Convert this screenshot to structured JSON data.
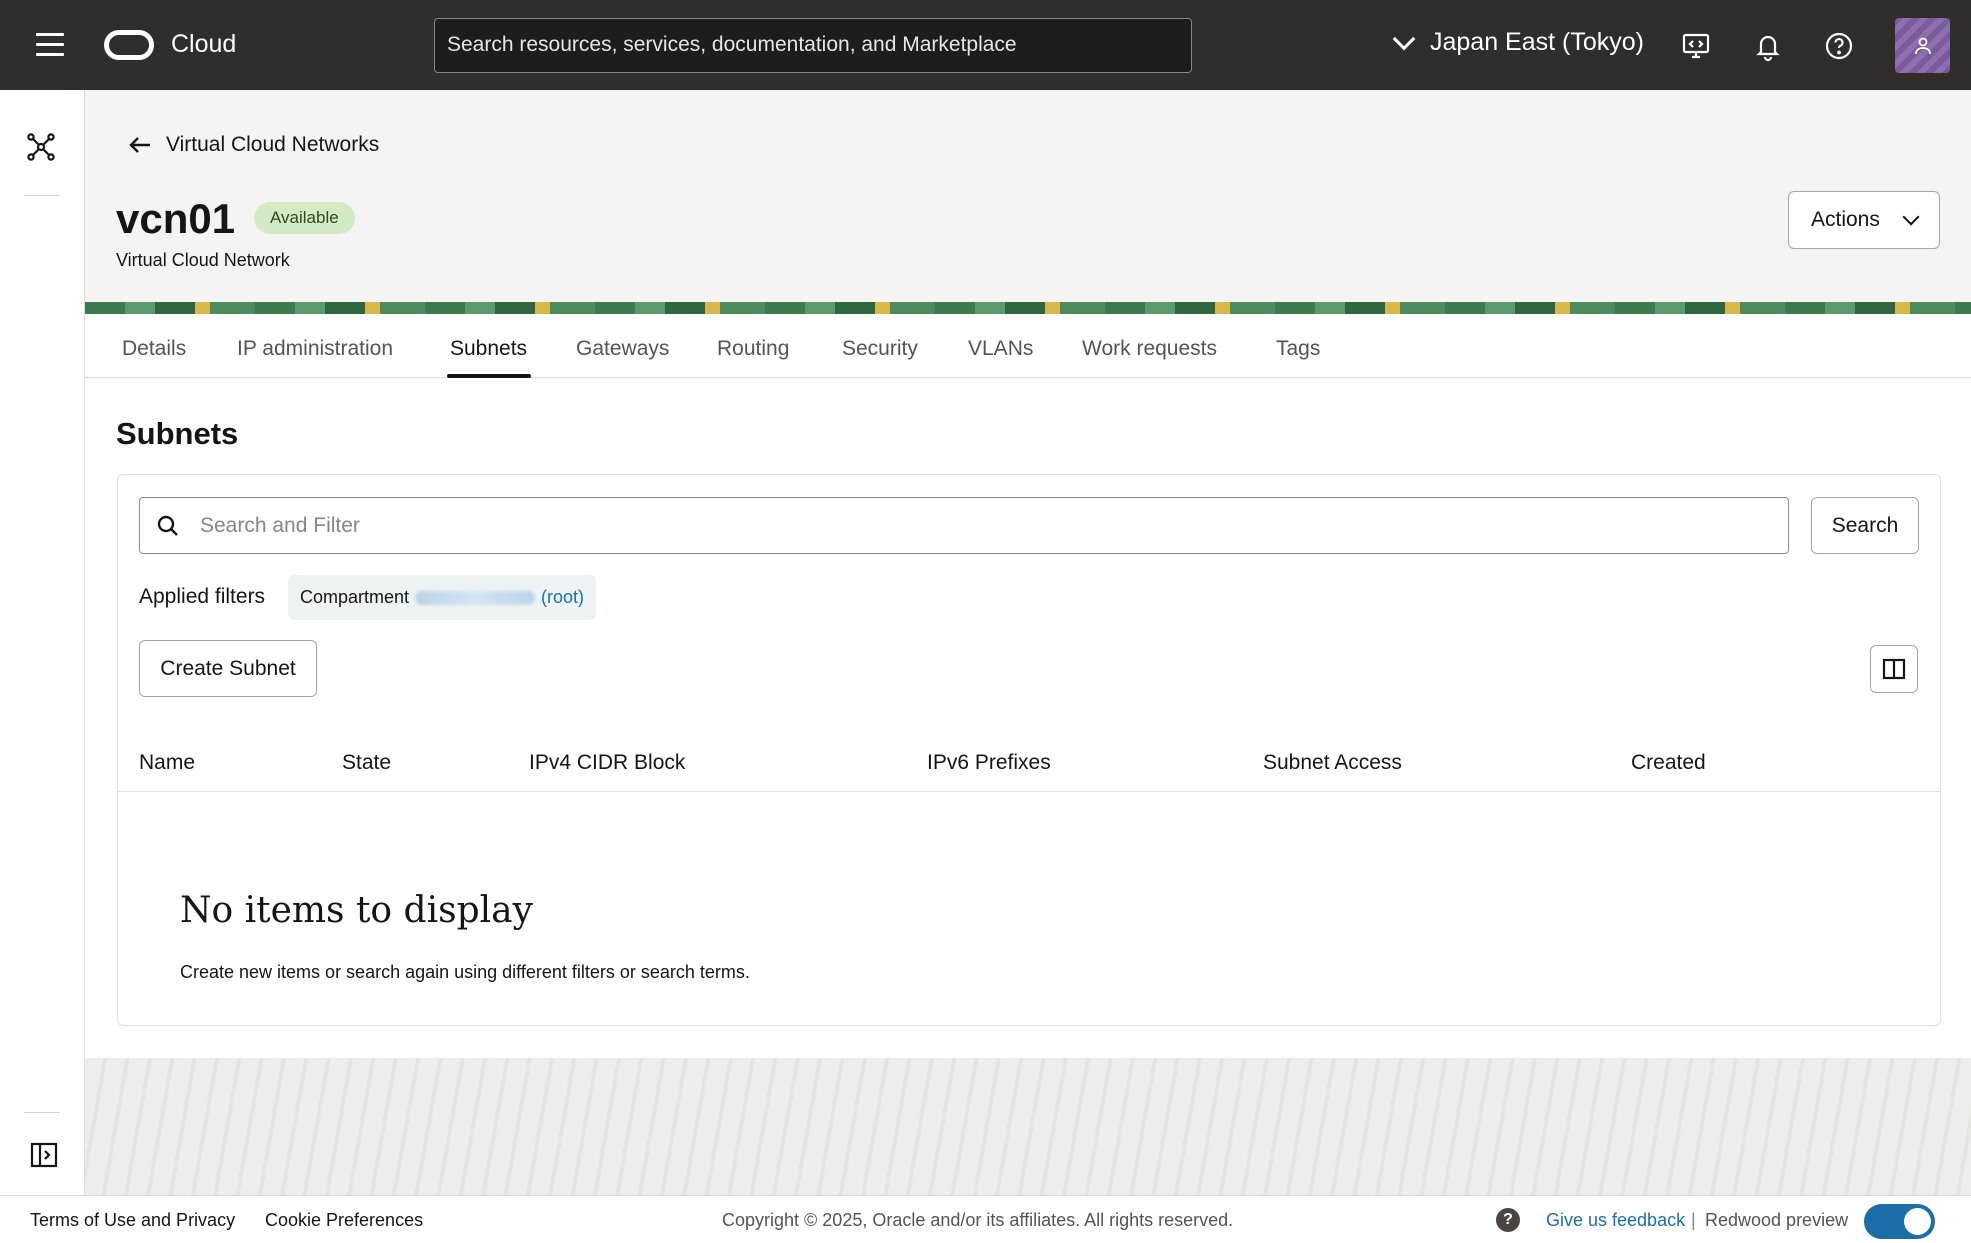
{
  "topbar": {
    "brand": "Cloud",
    "search_placeholder": "Search resources, services, documentation, and Marketplace",
    "region": "Japan East (Tokyo)"
  },
  "header": {
    "back_label": "Virtual Cloud Networks",
    "title": "vcn01",
    "status": "Available",
    "subtitle": "Virtual Cloud Network",
    "actions_label": "Actions"
  },
  "tabs": [
    {
      "label": "Details"
    },
    {
      "label": "IP administration"
    },
    {
      "label": "Subnets"
    },
    {
      "label": "Gateways"
    },
    {
      "label": "Routing"
    },
    {
      "label": "Security"
    },
    {
      "label": "VLANs"
    },
    {
      "label": "Work requests"
    },
    {
      "label": "Tags"
    }
  ],
  "active_tab": "Subnets",
  "subnets": {
    "section_title": "Subnets",
    "filter_placeholder": "Search and Filter",
    "search_button": "Search",
    "applied_filters_label": "Applied filters",
    "filter_chip_prefix": "Compartment",
    "filter_chip_suffix": "(root)",
    "create_button": "Create Subnet",
    "columns": [
      "Name",
      "State",
      "IPv4 CIDR Block",
      "IPv6 Prefixes",
      "Subnet Access",
      "Created"
    ],
    "empty_title": "No items to display",
    "empty_description": "Create new items or search again using different filters or search terms."
  },
  "footer": {
    "terms": "Terms of Use and Privacy",
    "cookies": "Cookie Preferences",
    "copyright": "Copyright © 2025, Oracle and/or its affiliates. All rights reserved.",
    "help_glyph": "?",
    "feedback": "Give us feedback",
    "separator": "|",
    "redwood": "Redwood preview",
    "redwood_enabled": true
  },
  "colors": {
    "topbar_bg": "#312d2a",
    "status_badge_bg": "#d4eac6",
    "link": "#1b6ea8",
    "toggle_on": "#1b6ea8"
  }
}
